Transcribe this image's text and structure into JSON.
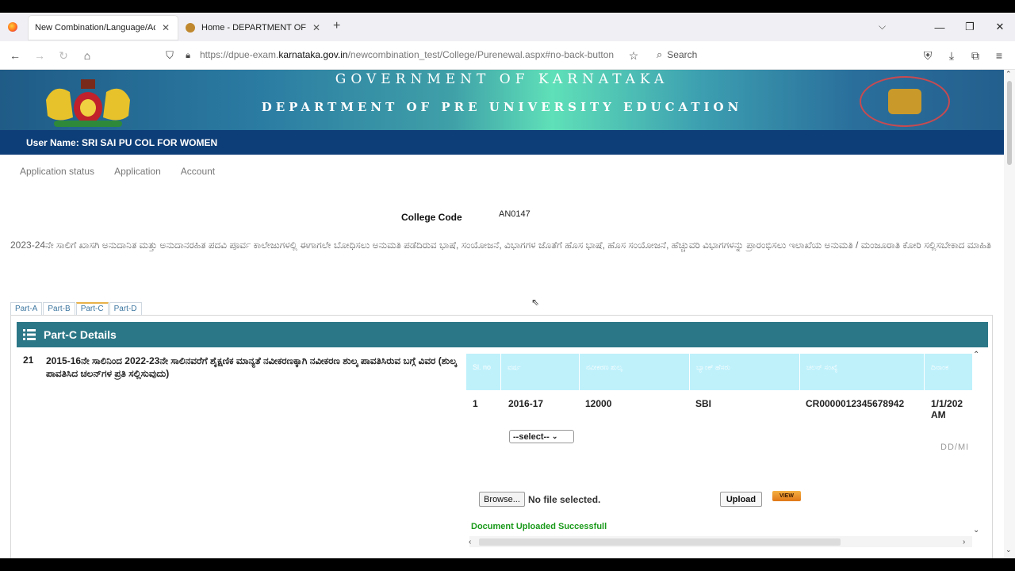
{
  "browser": {
    "tabs": [
      {
        "label": "New Combination/Language/Addi",
        "close": "✕"
      },
      {
        "label": "Home - DEPARTMENT OF PRE U",
        "close": "✕"
      }
    ],
    "new_tab": "+",
    "url_prefix": "https://dpue-exam.",
    "url_domain": "karnataka.gov.in",
    "url_path": "/newcombination_test/College/Purenewal.aspx#no-back-button",
    "search_label": "Search"
  },
  "banner": {
    "line1": "GOVERNMENT OF KARNATAKA",
    "line2": "DEPARTMENT OF PRE UNIVERSITY EDUCATION",
    "user_line": "User Name: SRI SAI PU COL FOR WOMEN"
  },
  "menu": [
    "Application status",
    "Application",
    "Account"
  ],
  "college": {
    "label": "College Code",
    "value": "AN0147"
  },
  "description": "2023-24ನೇ ಸಾಲಿಗೆ ಖಾಸಗಿ ಅನುದಾನಿತ ಮತ್ತು ಅನುದಾನರಹಿತ ಪದವಿ ಪೂರ್ವ ಕಾಲೇಜುಗಳಲ್ಲಿ ಈಗಾಗಲೇ ಬೋಧಿಸಲು ಅನುಮತಿ ಪಡೆದಿರುವ ಭಾಷೆ, ಸಂಯೋಜನೆ, ವಿಭಾಗಗಳ ಜೊತೆಗೆ ಹೊಸ ಭಾಷೆ, ಹೊಸ ಸಂಯೋಜನೆ, ಹೆಚ್ಚುವರಿ ವಿಭಾಗಗಳನ್ನು ಪ್ರಾರಂಭಿಸಲು ಇಲಾಖೆಯ ಅನುಮತಿ / ಮಂಜೂರಾತಿ ಕೋರಿ ಸಲ್ಲಿಸಬೇಕಾದ ಮಾಹಿತಿ",
  "part_tabs": [
    "Part-A",
    "Part-B",
    "Part-C",
    "Part-D"
  ],
  "active_part": "Part-C",
  "panel": {
    "title": "Part-C Details",
    "item_no": "21",
    "item_desc": "2015-16ನೇ ಸಾಲಿನಿಂದ 2022-23ನೇ ಸಾಲಿನವರೆಗೆ ಶೈಕ್ಷಣಿಕ ಮಾನ್ಯತೆ ನವೀಕರಣಕ್ಕಾಗಿ ನವೀಕರಣ ಶುಲ್ಕ ಪಾವತಿಸಿರುವ ಬಗ್ಗೆ ವಿವರ (ಶುಲ್ಕ ಪಾವತಿಸಿದ ಚಲನ್‌ಗಳ ಪ್ರತಿ ಸಲ್ಲಿಸುವುದು)",
    "table_headers": [
      "Sl. no",
      "ವರ್ಷ",
      "ನವೀಕರಣ ಶುಲ್ಕ",
      "ಬ್ಯಾಂಕ್ ಹೆಸರು",
      "ಚಲನ್ ಸಂಖ್ಯೆ",
      "ದಿನಾಂಕ"
    ],
    "row": [
      "1",
      "2016-17",
      "12000",
      "SBI",
      "CR0000012345678942",
      "1/1/202"
    ],
    "row_time": "AM",
    "select_value": "--select--",
    "date_placeholder": "DD/MI",
    "browse_label": "Browse...",
    "no_file": "No file selected.",
    "upload_label": "Upload",
    "view_label": "VIEW",
    "success_msg": "Document Uploaded Successfull"
  }
}
